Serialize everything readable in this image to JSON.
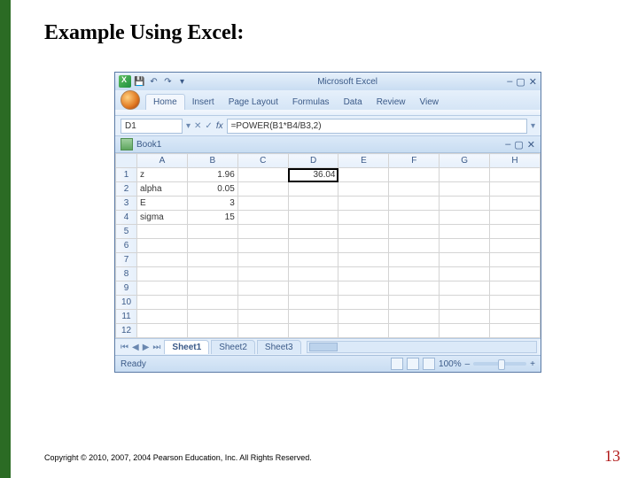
{
  "slide": {
    "title": "Example Using Excel:",
    "copyright": "Copyright © 2010, 2007, 2004 Pearson Education, Inc. All Rights Reserved.",
    "page_number": "13"
  },
  "titlebar": {
    "app_name": "Microsoft Excel",
    "min": "–",
    "restore": "▢",
    "close": "✕"
  },
  "ribbon": {
    "tabs": [
      "Home",
      "Insert",
      "Page Layout",
      "Formulas",
      "Data",
      "Review",
      "View"
    ],
    "active_index": 0
  },
  "formula_bar": {
    "name_box": "D1",
    "fx_label": "fx",
    "formula": "=POWER(B1*B4/B3,2)"
  },
  "workbook": {
    "title": "Book1",
    "min": "–",
    "restore": "▢",
    "close": "✕"
  },
  "grid": {
    "columns": [
      "A",
      "B",
      "C",
      "D",
      "E",
      "F",
      "G",
      "H"
    ],
    "row_headers": [
      "1",
      "2",
      "3",
      "4",
      "5",
      "6",
      "7",
      "8",
      "9",
      "10",
      "11",
      "12"
    ],
    "active_col": "D",
    "active_row": "1",
    "cells": {
      "r1": {
        "A": "z",
        "B": "1.96",
        "D": "36.04"
      },
      "r2": {
        "A": "alpha",
        "B": "0.05"
      },
      "r3": {
        "A": "E",
        "B": "3"
      },
      "r4": {
        "A": "sigma",
        "B": "15"
      }
    }
  },
  "sheet_tabs": {
    "tabs": [
      "Sheet1",
      "Sheet2",
      "Sheet3"
    ],
    "active_index": 0
  },
  "statusbar": {
    "status": "Ready",
    "zoom": "100%",
    "minus": "–",
    "plus": "+"
  }
}
